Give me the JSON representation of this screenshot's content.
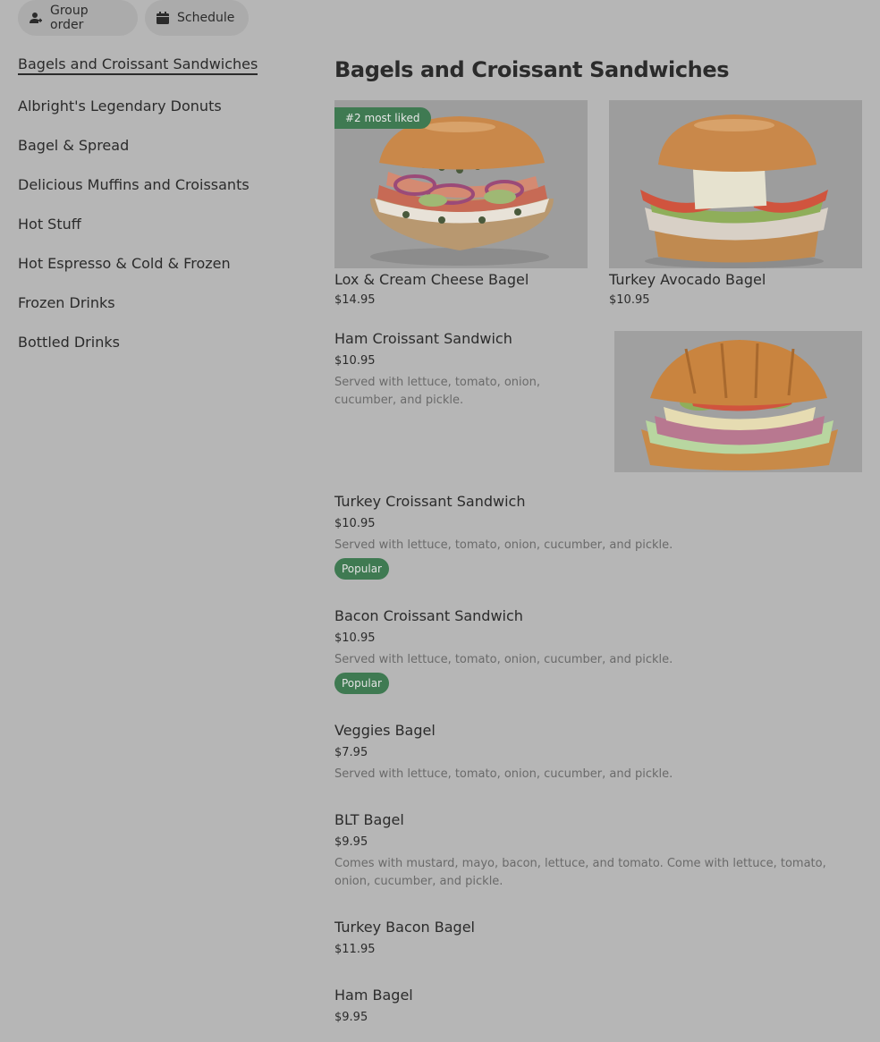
{
  "top_buttons": {
    "group_order": "Group order",
    "schedule": "Schedule"
  },
  "sidebar": {
    "items": [
      {
        "label": "Bagels and Croissant Sandwiches",
        "active": true
      },
      {
        "label": "Albright's Legendary Donuts"
      },
      {
        "label": "Bagel & Spread"
      },
      {
        "label": "Delicious Muffins and Croissants"
      },
      {
        "label": "Hot Stuff"
      },
      {
        "label": "Hot Espresso & Cold & Frozen"
      },
      {
        "label": "Frozen Drinks"
      },
      {
        "label": "Bottled Drinks"
      }
    ]
  },
  "section": {
    "title": "Bagels and Croissant Sandwiches"
  },
  "featured": [
    {
      "name": "Lox & Cream Cheese Bagel",
      "price": "$14.95",
      "badge": "#2 most liked"
    },
    {
      "name": "Turkey Avocado Bagel",
      "price": "$10.95"
    }
  ],
  "items": [
    {
      "name": "Ham Croissant Sandwich",
      "price": "$10.95",
      "desc": "Served with lettuce, tomato, onion, cucumber, and pickle."
    },
    {
      "name": "Turkey Croissant Sandwich",
      "price": "$10.95",
      "desc": "Served with lettuce, tomato, onion, cucumber, and pickle.",
      "tag": "Popular"
    },
    {
      "name": "Bacon Croissant Sandwich",
      "price": "$10.95",
      "desc": "Served with lettuce, tomato, onion, cucumber, and pickle.",
      "tag": "Popular"
    },
    {
      "name": "Veggies Bagel",
      "price": "$7.95",
      "desc": "Served with lettuce, tomato, onion, cucumber, and pickle."
    },
    {
      "name": "BLT Bagel",
      "price": "$9.95",
      "desc": "Comes with mustard, mayo, bacon, lettuce, and tomato. Come with lettuce, tomato, onion, cucumber, and pickle."
    },
    {
      "name": "Turkey Bacon Bagel",
      "price": "$11.95"
    },
    {
      "name": "Ham Bagel",
      "price": "$9.95"
    }
  ],
  "colors": {
    "overlay_bg": "#b6b6b6",
    "badge_green": "#3f7a52"
  },
  "icons": {
    "group_order": "person-add-icon",
    "schedule": "calendar-icon"
  }
}
